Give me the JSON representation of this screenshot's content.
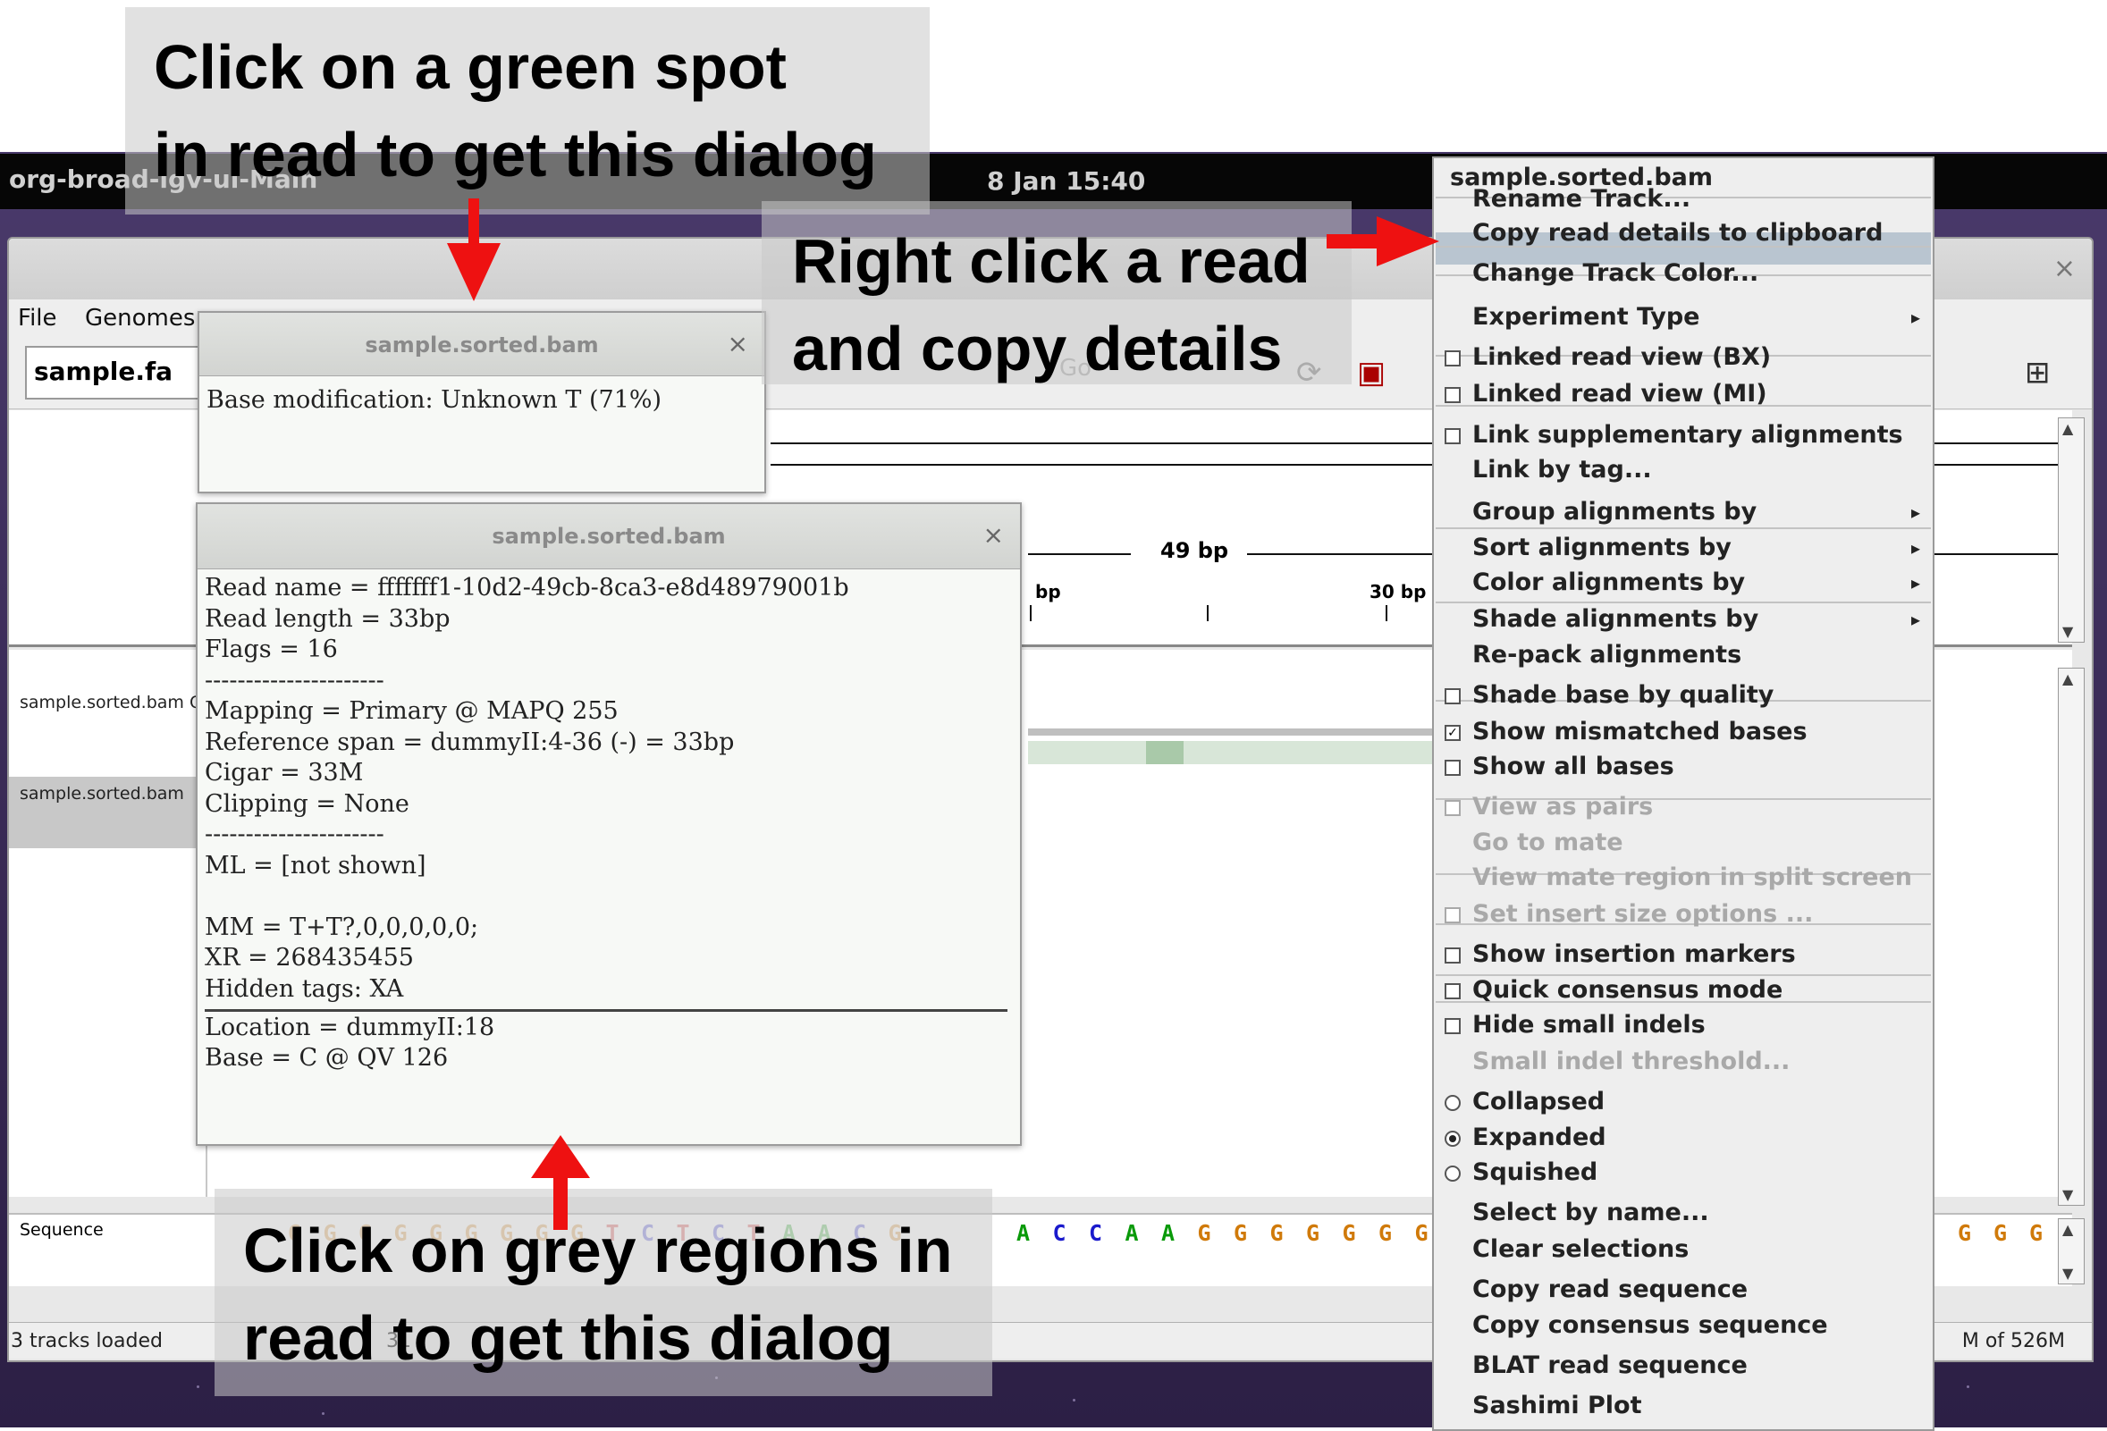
{
  "annotations": {
    "top_left_line1": "Click on a green spot",
    "top_left_line2": "in read to get this dialog",
    "top_right_line1": "Right click a read",
    "top_right_line2": "and copy details",
    "bottom_line1": "Click on grey regions in",
    "bottom_line2": "read to get this dialog"
  },
  "desktop": {
    "app_name": "org-broad-igv-ui-Main",
    "clock": "8 Jan  15:40"
  },
  "igv": {
    "menu": {
      "file": "File",
      "genomes": "Genomes"
    },
    "genome": "sample.fa",
    "go_label": "Go",
    "ruler": {
      "span": "49 bp",
      "tick_bp": "bp",
      "tick_30": "30 bp"
    },
    "tracks": [
      "sample.sorted.bam C",
      "sample.sorted.bam"
    ],
    "sequence_label": "Sequence",
    "sequence_bases_left": [
      "G",
      "G",
      "G",
      "G",
      "G",
      "G",
      "G",
      "G",
      "G",
      "T",
      "C",
      "T",
      "C",
      "T",
      "A",
      "A",
      "C",
      "G"
    ],
    "sequence_bases_main": [
      "A",
      "C",
      "C",
      "A",
      "A",
      "G",
      "G",
      "G",
      "G",
      "G",
      "G",
      "G"
    ],
    "sequence_bases_right": [
      "G",
      "G",
      "G"
    ],
    "status_left": "3 tracks loaded",
    "status_left_partial": "31",
    "status_right": "M of 526M"
  },
  "dialog_mod": {
    "title": "sample.sorted.bam",
    "text": "Base modification: Unknown T (71%)"
  },
  "dialog_read": {
    "title": "sample.sorted.bam",
    "lines": [
      "Read name = fffffff1-10d2-49cb-8ca3-e8d48979001b",
      "Read length = 33bp",
      "Flags = 16",
      "----------------------",
      "Mapping = Primary @ MAPQ 255",
      "Reference span = dummyII:4-36 (-) = 33bp",
      "Cigar = 33M",
      "Clipping = None",
      "----------------------",
      "ML = [not shown]",
      "",
      "MM = T+T?,0,0,0,0,0;",
      "XR = 268435455",
      "Hidden tags: XA"
    ],
    "location": "Location = dummyII:18",
    "base": "Base = C @ QV 126"
  },
  "context_menu": {
    "header": "sample.sorted.bam",
    "items": [
      {
        "label": "Rename Track..."
      },
      {
        "label": "Copy read details to clipboard",
        "highlighted": true
      },
      {
        "label": "Change Track Color..."
      },
      {
        "label": "Experiment Type",
        "submenu": true
      },
      {
        "label": "Linked read view (BX)",
        "check": false
      },
      {
        "label": "Linked read view (MI)",
        "check": false
      },
      {
        "label": "Link supplementary alignments",
        "check": false
      },
      {
        "label": "Link by tag..."
      },
      {
        "label": "Group alignments by",
        "submenu": true
      },
      {
        "label": "Sort alignments by",
        "submenu": true
      },
      {
        "label": "Color alignments by",
        "submenu": true
      },
      {
        "label": "Shade alignments by",
        "submenu": true
      },
      {
        "label": "Re-pack alignments"
      },
      {
        "label": "Shade base by quality",
        "check": false
      },
      {
        "label": "Show mismatched bases",
        "check": true
      },
      {
        "label": "Show all bases",
        "check": false
      },
      {
        "label": "View as pairs",
        "check": false,
        "disabled": true
      },
      {
        "label": "Go to mate",
        "disabled": true
      },
      {
        "label": "View mate region in split screen",
        "disabled": true
      },
      {
        "label": "Set insert size options ...",
        "check": false,
        "disabled": true
      },
      {
        "label": "Show insertion markers",
        "check": false
      },
      {
        "label": "Quick consensus mode",
        "check": false
      },
      {
        "label": "Hide small indels",
        "check": false
      },
      {
        "label": "Small indel threshold...",
        "disabled": true
      },
      {
        "label": "Collapsed",
        "radio": false
      },
      {
        "label": "Expanded",
        "radio": true
      },
      {
        "label": "Squished",
        "radio": false
      },
      {
        "label": "Select by name..."
      },
      {
        "label": "Clear selections"
      },
      {
        "label": "Copy read sequence"
      },
      {
        "label": "Copy consensus sequence"
      },
      {
        "label": "BLAT read sequence"
      },
      {
        "label": "Sashimi Plot"
      }
    ]
  },
  "colors": {
    "accent_red": "#ee1111",
    "base_A": "#0a9a0a",
    "base_C": "#1a1acc",
    "base_G": "#d07a0a",
    "base_T": "#cc1111",
    "menu_highlight": "#b9c5d0"
  }
}
